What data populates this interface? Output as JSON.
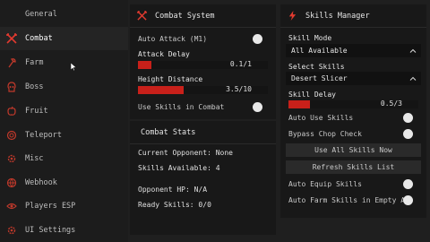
{
  "sidebar": {
    "items": [
      {
        "label": "General",
        "icon": "none"
      },
      {
        "label": "Combat",
        "icon": "crossed-swords-icon"
      },
      {
        "label": "Farm",
        "icon": "axe-icon"
      },
      {
        "label": "Boss",
        "icon": "skull-icon"
      },
      {
        "label": "Fruit",
        "icon": "apple-icon"
      },
      {
        "label": "Teleport",
        "icon": "portal-icon"
      },
      {
        "label": "Misc",
        "icon": "gear-icon"
      },
      {
        "label": "Webhook",
        "icon": "globe-icon"
      },
      {
        "label": "Players ESP",
        "icon": "eye-icon"
      },
      {
        "label": "UI Settings",
        "icon": "gear-icon"
      }
    ],
    "active": "Combat"
  },
  "combat": {
    "title": "Combat System",
    "auto_attack_label": "Auto Attack (M1)",
    "auto_attack_on": false,
    "attack_delay_label": "Attack Delay",
    "attack_delay_value": "0.1/1",
    "attack_delay_fraction": 0.1,
    "height_distance_label": "Height Distance",
    "height_distance_value": "3.5/10",
    "height_distance_fraction": 0.35,
    "use_skills_label": "Use Skills in Combat",
    "use_skills_on": false
  },
  "stats": {
    "title": "Combat Stats",
    "current_opponent": "Current Opponent: None",
    "skills_available": "Skills Available: 4",
    "opponent_hp": "Opponent HP: N/A",
    "ready_skills": "Ready Skills: 0/0"
  },
  "skills": {
    "title": "Skills Manager",
    "skill_mode_label": "Skill Mode",
    "skill_mode_value": "All Available",
    "select_skills_label": "Select Skills",
    "select_skills_value": "Desert Slicer",
    "skill_delay_label": "Skill Delay",
    "skill_delay_value": "0.5/3",
    "skill_delay_fraction": 0.1667,
    "auto_use_label": "Auto Use Skills",
    "bypass_label": "Bypass Chop Check",
    "use_all_button": "Use All Skills Now",
    "refresh_button": "Refresh Skills List",
    "auto_equip_label": "Auto Equip Skills",
    "auto_farm_empty_label": "Auto Farm Skills in Empty A"
  },
  "colors": {
    "accent": "#c8201a",
    "panel": "#181818",
    "background": "#1f1f1f"
  }
}
